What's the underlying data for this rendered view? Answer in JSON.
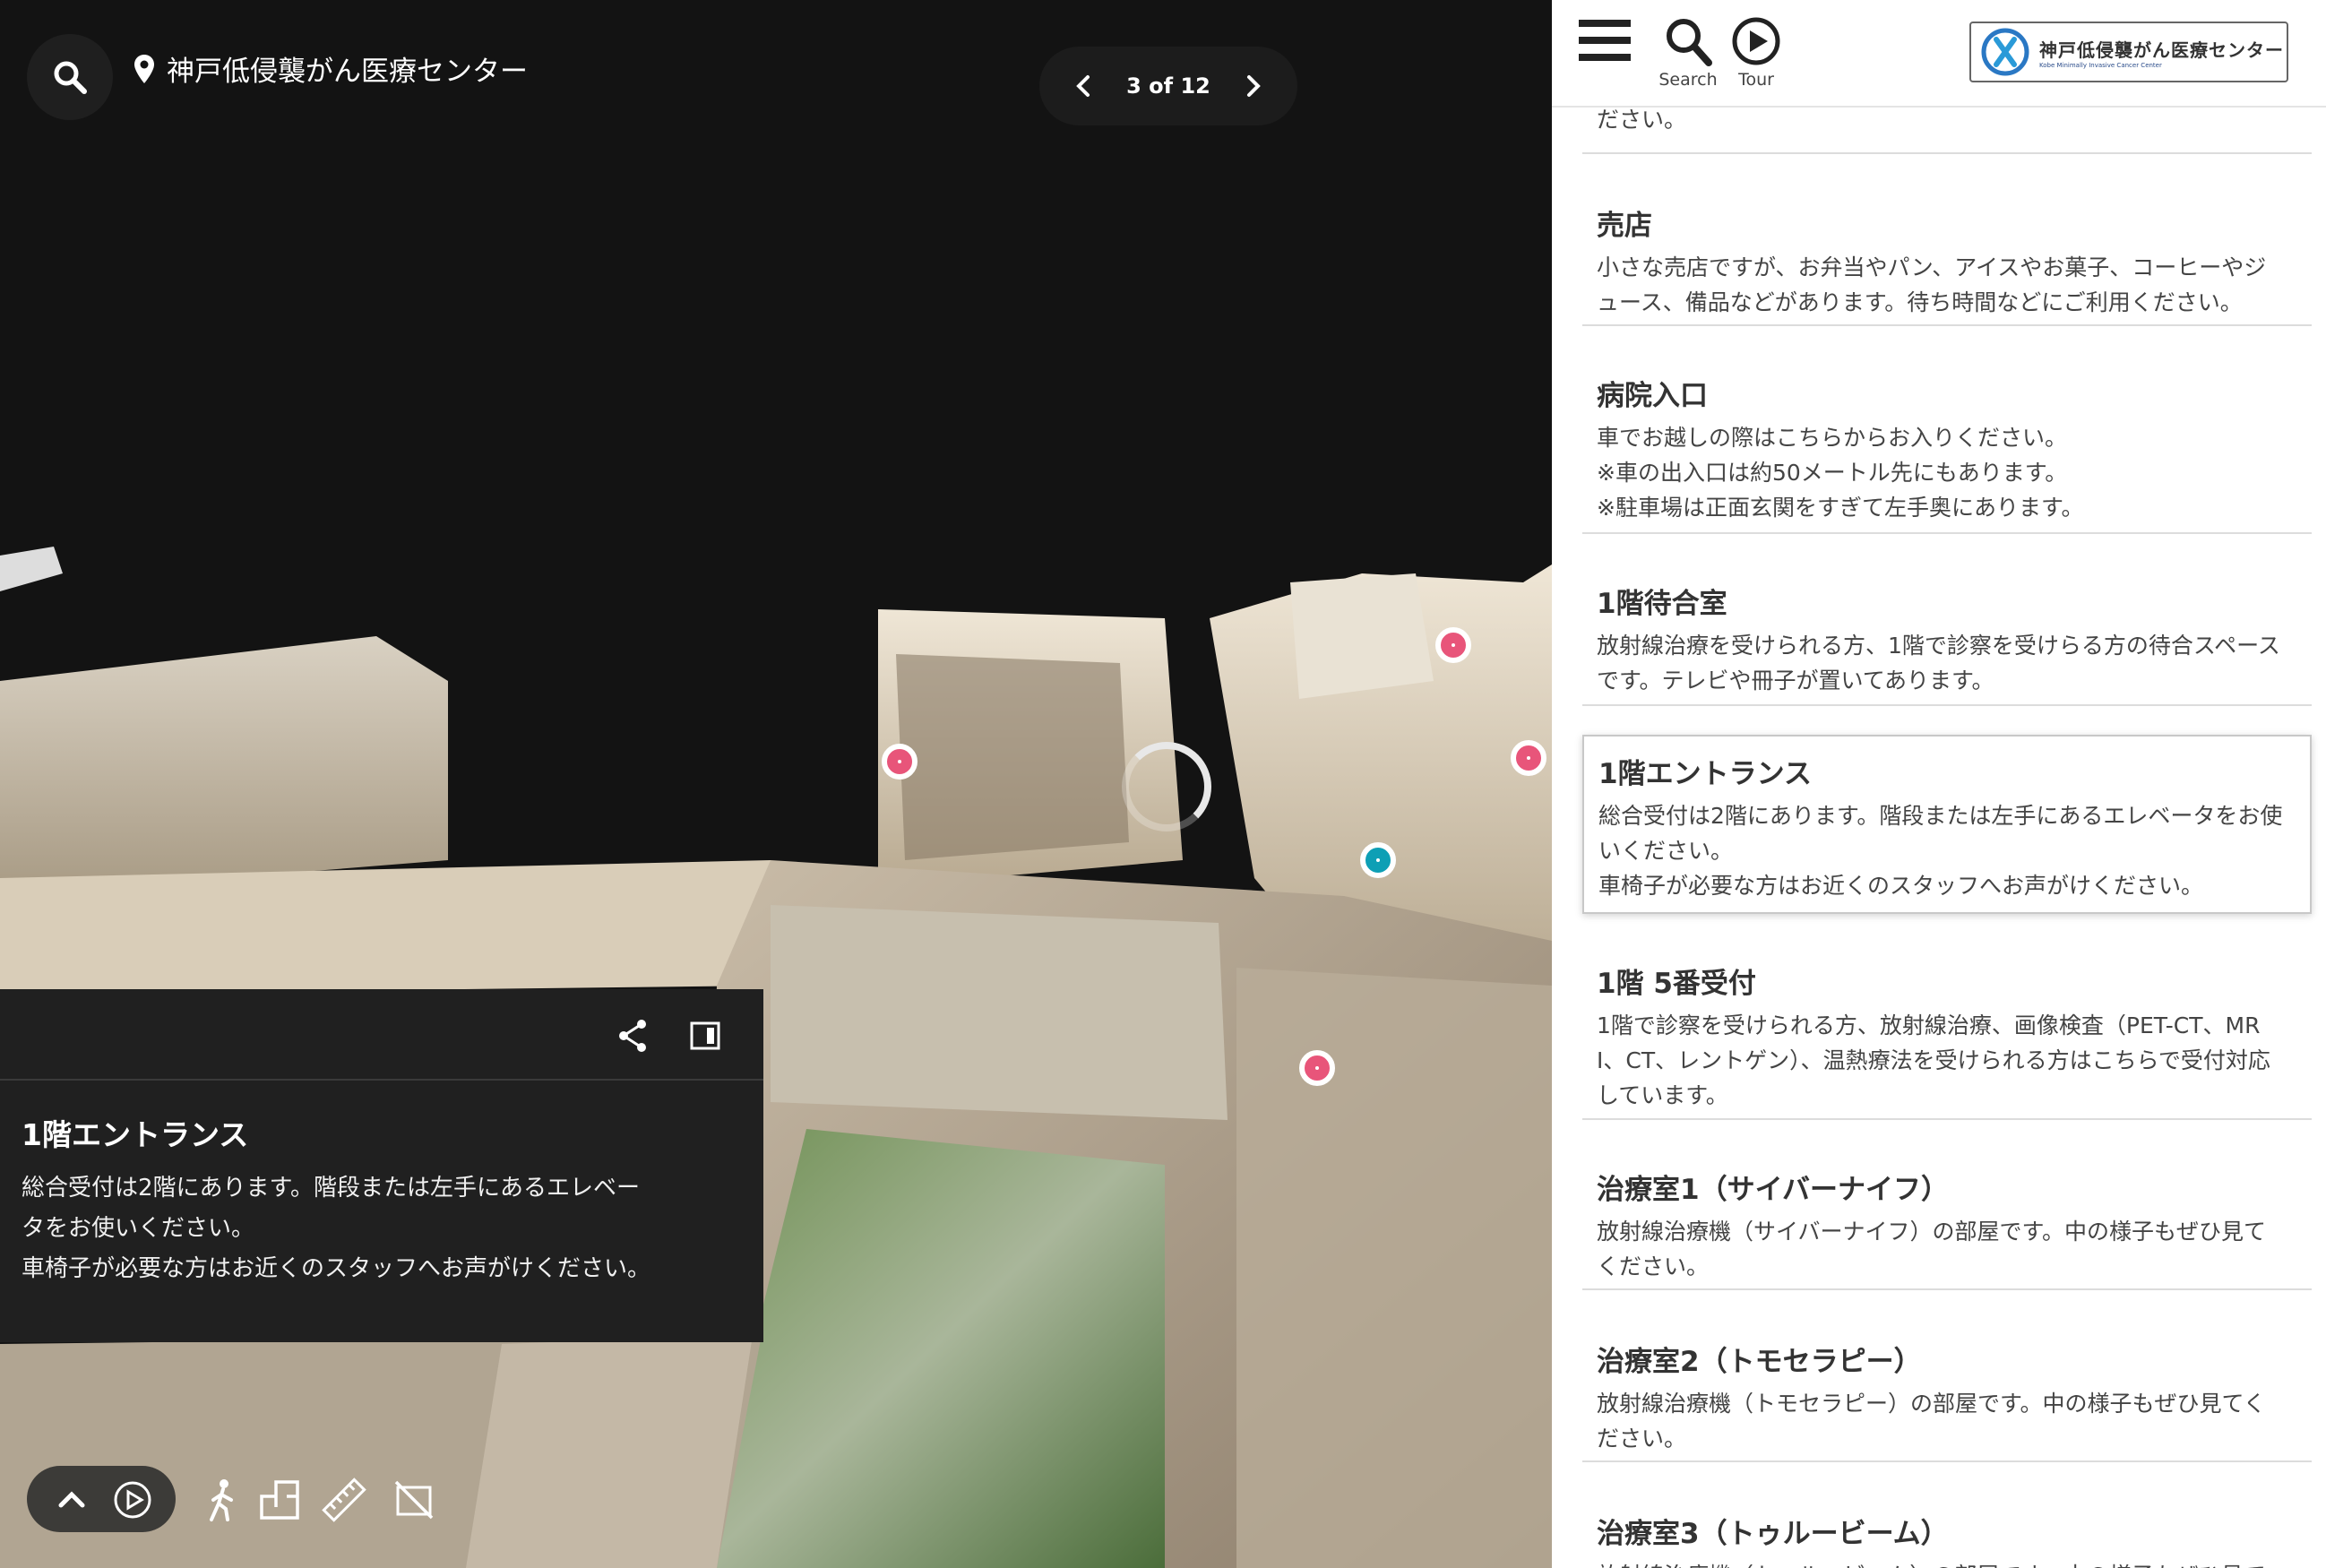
{
  "viewer": {
    "location_title": "神戸低侵襲がん医療センター",
    "pager": {
      "current": 3,
      "total": 12,
      "label": "3 of 12"
    },
    "info_card": {
      "title": "1階エントランス",
      "lines": [
        "総合受付は2階にあります。階段または左手にあるエレベー",
        "タをお使いください。",
        "車椅子が必要な方はお近くのスタッフへお声がけください。"
      ]
    },
    "icons": {
      "search": "search-icon",
      "location": "location-pin-icon",
      "prev": "chevron-left-icon",
      "next": "chevron-right-icon",
      "share": "share-icon",
      "dock": "dock-panel-icon",
      "collapse": "chevron-up-icon",
      "play": "play-icon",
      "walk": "walk-icon",
      "floorplan": "floorplan-icon",
      "measure": "measure-icon",
      "hide": "hide-tags-icon"
    },
    "colors": {
      "tag_pink": "#e8557a",
      "tag_teal": "#0e9fb5",
      "panel": "#202020"
    }
  },
  "sidebar": {
    "toolbar": {
      "search_label": "Search",
      "tour_label": "Tour"
    },
    "logo": {
      "text": "神戸低侵襲がん医療センター",
      "sub": "Kobe Minimally Invasive Cancer Center"
    },
    "partial_text": "ださい。",
    "items": [
      {
        "title": "売店",
        "desc": "小さな売店ですが、お弁当やパン、アイスやお菓子、コーヒーやジ\nュース、備品などがあります。待ち時間などにご利用ください。"
      },
      {
        "title": "病院入口",
        "desc": "車でお越しの際はこちらからお入りください。\n※車の出入口は約50メートル先にもあります。\n※駐車場は正面玄関をすぎて左手奥にあります。"
      },
      {
        "title": "1階待合室",
        "desc": "放射線治療を受けられる方、1階で診察を受けらる方の待合スペース\nです。テレビや冊子が置いてあります。"
      },
      {
        "title": "1階エントランス",
        "desc": "総合受付は2階にあります。階段または左手にあるエレベータをお使\nいください。\n車椅子が必要な方はお近くのスタッフへお声がけください。"
      },
      {
        "title": "1階 5番受付",
        "desc": "1階で診察を受けられる方、放射線治療、画像検査（PET-CT、MR\nI、CT、レントゲン）、温熱療法を受けられる方はこちらで受付対応\nしています。"
      },
      {
        "title": "治療室1（サイバーナイフ）",
        "desc": "放射線治療機（サイバーナイフ）の部屋です。中の様子もぜひ見て\nください。"
      },
      {
        "title": "治療室2（トモセラピー）",
        "desc": "放射線治療機（トモセラピー）の部屋です。中の様子もぜひ見てく\nださい。"
      },
      {
        "title": "治療室3（トゥルービーム）",
        "desc": "放射線治療機（トゥルービーム）の部屋です。中の様子もぜひ見て"
      }
    ]
  }
}
